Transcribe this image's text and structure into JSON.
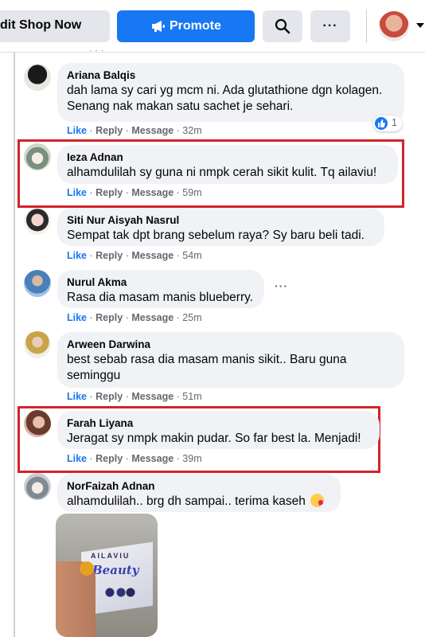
{
  "toolbar": {
    "edit_shop_label": "dit Shop Now",
    "promote_label": "Promote",
    "more_label": "···"
  },
  "thread": {
    "truncated_above": "· · ·"
  },
  "actions": {
    "like": "Like",
    "reply": "Reply",
    "message": "Message",
    "sep": "·"
  },
  "comments": [
    {
      "name": "Ariana Balqis",
      "text": "dah lama sy cari yg mcm ni. Ada glutathione dgn kolagen. Senang nak makan satu sachet je sehari.",
      "time": "32m",
      "reactions": "1",
      "highlighted": false
    },
    {
      "name": "Ieza Adnan",
      "text": "alhamdulilah sy guna ni nmpk cerah sikit kulit. Tq ailaviu!",
      "time": "59m",
      "highlighted": true
    },
    {
      "name": "Siti Nur Aisyah Nasrul",
      "text": "Sempat tak dpt brang sebelum raya? Sy baru beli tadi.",
      "time": "54m",
      "highlighted": false
    },
    {
      "name": "Nurul Akma",
      "text": "Rasa dia masam manis blueberry.",
      "time": "25m",
      "highlighted": false,
      "more": "···"
    },
    {
      "name": "Arween Darwina",
      "text": "best sebab rasa dia masam manis sikit.. Baru guna seminggu",
      "time": "51m",
      "highlighted": false
    },
    {
      "name": "Farah Liyana",
      "text": "Jeragat sy nmpk makin pudar. So far best la. Menjadi!",
      "time": "39m",
      "highlighted": true
    },
    {
      "name": "NorFaizah Adnan",
      "text": "alhamdulilah.. brg dh sampai.. terima kaseh",
      "emoji": "face-blowing-kiss",
      "highlighted": false
    }
  ],
  "attachment": {
    "brand": "AILAVIU",
    "product": "Beauty"
  },
  "colors": {
    "facebook_blue": "#1877f2",
    "bubble_grey": "#f0f2f5",
    "highlight_red": "#d2232a"
  }
}
